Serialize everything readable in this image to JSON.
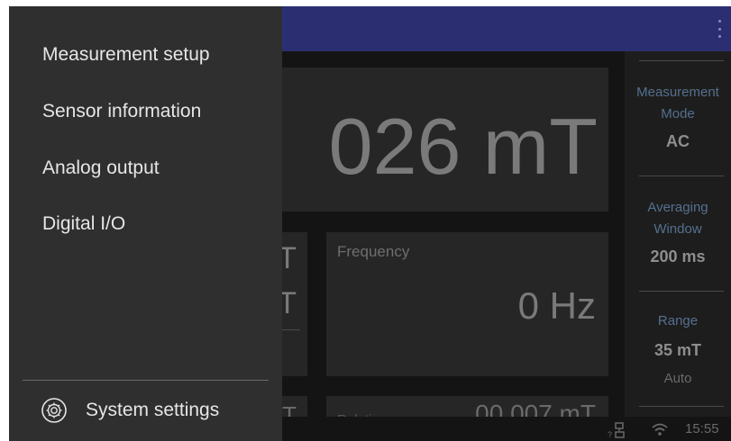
{
  "appbar": {
    "menu_icon": "more-vert-icon",
    "color": "#2b2f72"
  },
  "main": {
    "reading": "026 mT",
    "left_card": {
      "value_1": "T",
      "value_2": "T"
    },
    "frequency": {
      "label": "Frequency",
      "value": "0 Hz"
    },
    "bottom_left": {
      "value": "T"
    },
    "bottom_right": {
      "label": "Relati",
      "value": "00.007 mT"
    }
  },
  "right_panel": {
    "measurement_mode": {
      "label_1": "Measurement",
      "label_2": "Mode",
      "value": "AC"
    },
    "averaging_window": {
      "label_1": "Averaging",
      "label_2": "Window",
      "value": "200 ms"
    },
    "range": {
      "label": "Range",
      "value": "35 mT",
      "sub": "Auto"
    }
  },
  "status_bar": {
    "network_icon": "network-unknown-icon",
    "wifi_icon": "wifi-icon",
    "time": "15:55"
  },
  "drawer": {
    "items": [
      {
        "label": "Measurement setup"
      },
      {
        "label": "Sensor information"
      },
      {
        "label": "Analog output"
      },
      {
        "label": "Digital I/O"
      }
    ],
    "settings": {
      "label": "System settings",
      "icon": "gear-icon"
    }
  },
  "colors": {
    "accent_label": "#54708f",
    "drawer_bg": "#2f2f2f",
    "screen_bg": "#141414"
  }
}
